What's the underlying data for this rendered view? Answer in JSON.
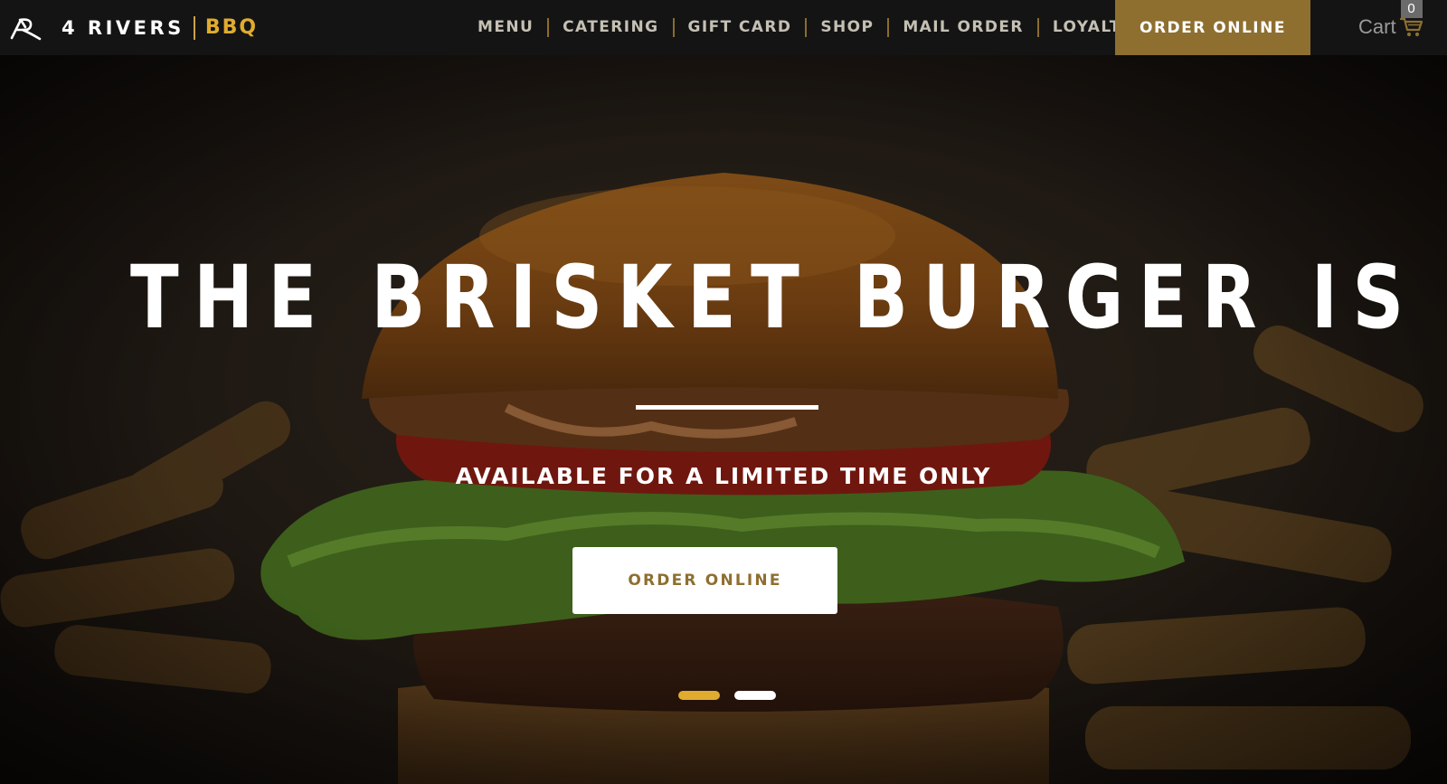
{
  "header": {
    "logo_wordmark": "4 RIVERS",
    "logo_sub": "BBQ",
    "nav": [
      {
        "label": "MENU"
      },
      {
        "label": "CATERING"
      },
      {
        "label": "GIFT CARD"
      },
      {
        "label": "SHOP"
      },
      {
        "label": "MAIL ORDER"
      },
      {
        "label": "LOYALTY"
      }
    ],
    "order_button": "ORDER ONLINE",
    "cart": {
      "label": "Cart",
      "count": "0",
      "icon": "shopping-cart-icon"
    }
  },
  "hero": {
    "title": "THE BRISKET BURGER IS BACK",
    "subtitle": "AVAILABLE FOR A LIMITED TIME ONLY",
    "cta": "ORDER ONLINE",
    "slides": {
      "total": 2,
      "active": 1
    }
  },
  "colors": {
    "header_bg": "#141414",
    "accent_gold": "#8e6f30",
    "bbq_yellow": "#e0ab2f",
    "nav_text": "#c5c0b4"
  }
}
